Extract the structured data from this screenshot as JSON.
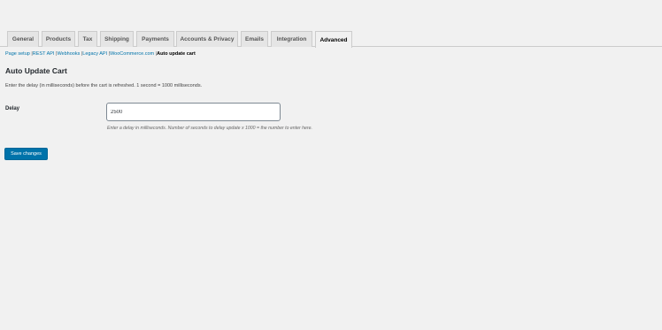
{
  "tabs": [
    {
      "label": "General"
    },
    {
      "label": "Products"
    },
    {
      "label": "Tax"
    },
    {
      "label": "Shipping"
    },
    {
      "label": "Payments"
    },
    {
      "label": "Accounts & Privacy"
    },
    {
      "label": "Emails"
    },
    {
      "label": "Integration"
    },
    {
      "label": "Advanced",
      "active": true
    }
  ],
  "subnav": {
    "items": [
      "Page setup",
      "REST API",
      "Webhooks",
      "Legacy API",
      "WooCommerce.com"
    ],
    "separator": "|",
    "current": "Auto update cart"
  },
  "section": {
    "title": "Auto Update Cart",
    "description": "Enter the delay (in milliseconds) before the cart is refreshed. 1 second = 1000 milliseconds."
  },
  "field": {
    "label": "Delay",
    "value": "2500",
    "description": "Enter a delay in milliseconds. Number of seconds to delay update x 1000 = the number to enter here."
  },
  "save_button_label": "Save changes",
  "colors": {
    "accent": "#0073aa",
    "page_background": "#f1f1f1"
  }
}
